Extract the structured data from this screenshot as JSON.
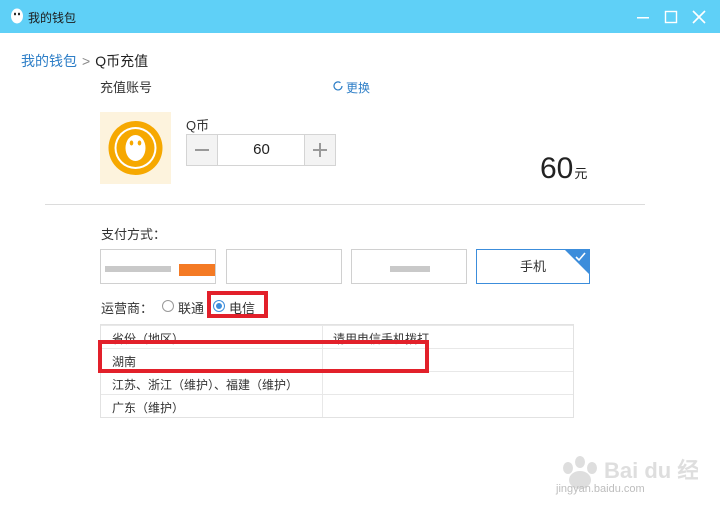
{
  "window": {
    "title": "我的钱包"
  },
  "breadcrumb": {
    "parent": "我的钱包",
    "separator": ">",
    "current": "Q币充值"
  },
  "account": {
    "label": "充值账号",
    "change_link": "更换"
  },
  "product": {
    "name": "Q币",
    "quantity": "60",
    "price_amount": "60",
    "price_unit": "元"
  },
  "payment": {
    "label": "支付方式：",
    "selected_option": "手机"
  },
  "carrier": {
    "label": "运营商：",
    "options": [
      "联通",
      "电信"
    ],
    "selected": "电信"
  },
  "table": {
    "headers": [
      "省份（地区）",
      "请用电信手机拨打"
    ],
    "rows": [
      [
        "湖南",
        ""
      ],
      [
        "江苏、浙江（维护）、福建（维护）",
        ""
      ],
      [
        "广东（维护）",
        ""
      ]
    ]
  },
  "watermark": {
    "brand": "Bai du 经验",
    "url": "jingyan.baidu.com"
  },
  "colors": {
    "titlebar": "#5fd0f7",
    "accent": "#3c8ddb",
    "link": "#2d7ec7",
    "highlight": "#e2202a"
  }
}
